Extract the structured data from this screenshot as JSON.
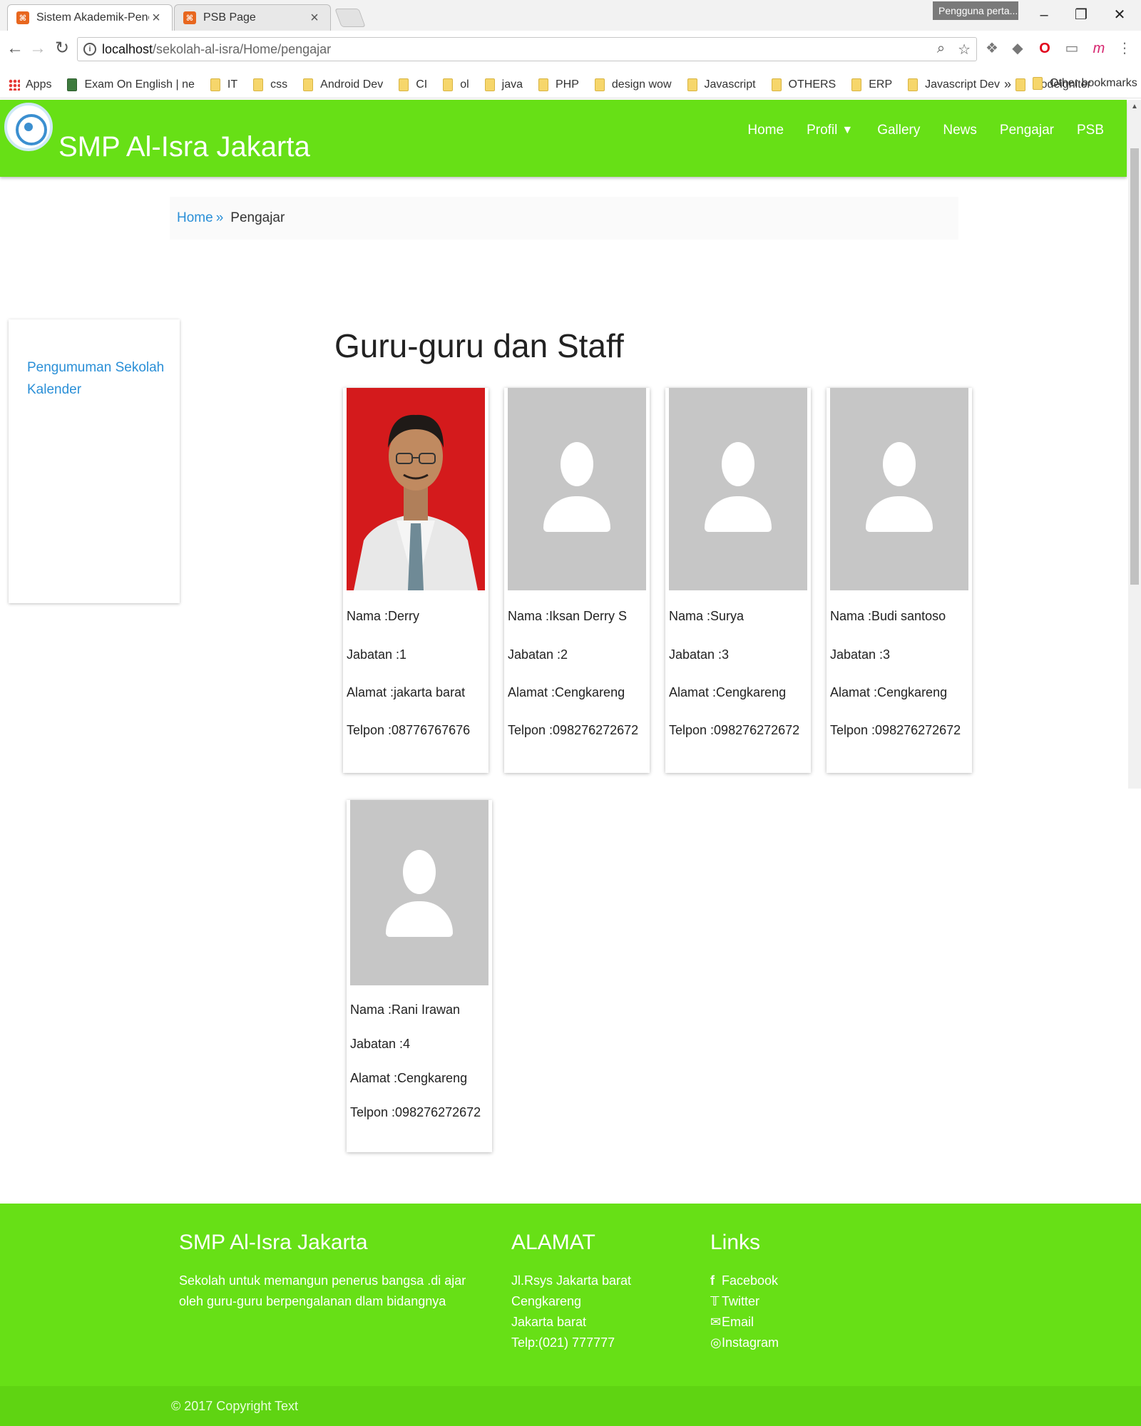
{
  "browser": {
    "tabs": [
      {
        "title": "Sistem Akademik-Penerim",
        "active": true
      },
      {
        "title": "PSB Page",
        "active": false
      }
    ],
    "profile_label": "Pengguna perta...",
    "url_host": "localhost",
    "url_path": "/sekolah-al-isra/Home/pengajar",
    "bookmarks": [
      "Apps",
      "Exam On English | ne",
      "IT",
      "css",
      "Android Dev",
      "CI",
      "ol",
      "java",
      "PHP",
      "design wow",
      "Javascript",
      "OTHERS",
      "ERP",
      "Javascript Dev",
      "Codeigniter"
    ],
    "bookmarks_more": "»",
    "other_bookmarks": "Other bookmarks"
  },
  "site": {
    "title": "SMP Al-Isra Jakarta",
    "nav": [
      "Home",
      "Profil",
      "Gallery",
      "News",
      "Pengajar",
      "PSB"
    ],
    "brand_color": "#67e016"
  },
  "breadcrumb": {
    "home": "Home",
    "separator": "»",
    "current": "Pengajar"
  },
  "sidebar": {
    "links": [
      "Pengumuman Sekolah",
      "Kalender"
    ]
  },
  "main": {
    "title": "Guru-guru dan Staff",
    "teachers": [
      {
        "nama": "Nama :Derry",
        "jabatan": "Jabatan :1",
        "alamat": "Alamat :jakarta barat",
        "telpon": "Telpon :08776767676",
        "photo": "portrait-photo"
      },
      {
        "nama": "Nama :Iksan Derry S",
        "jabatan": "Jabatan :2",
        "alamat": "Alamat :Cengkareng",
        "telpon": "Telpon :098276272672",
        "photo": "placeholder-avatar"
      },
      {
        "nama": "Nama :Surya",
        "jabatan": "Jabatan :3",
        "alamat": "Alamat :Cengkareng",
        "telpon": "Telpon :098276272672",
        "photo": "placeholder-avatar"
      },
      {
        "nama": "Nama :Budi santoso",
        "jabatan": "Jabatan :3",
        "alamat": "Alamat :Cengkareng",
        "telpon": "Telpon :098276272672",
        "photo": "placeholder-avatar"
      },
      {
        "nama": "Nama :Rani Irawan",
        "jabatan": "Jabatan :4",
        "alamat": "Alamat :Cengkareng",
        "telpon": "Telpon :098276272672",
        "photo": "placeholder-avatar"
      }
    ]
  },
  "footer": {
    "about_title": "SMP Al-Isra Jakarta",
    "about_text": "Sekolah untuk memangun penerus bangsa .di ajar oleh guru-guru berpengalanan dlam bidangnya",
    "address_title": "ALAMAT",
    "address_lines": [
      "Jl.Rsys Jakarta barat",
      "Cengkareng",
      "Jakarta barat",
      "Telp:(021) 777777"
    ],
    "links_title": "Links",
    "links": [
      {
        "label": "Facebook",
        "icon": "facebook-icon"
      },
      {
        "label": "Twitter",
        "icon": "twitter-icon"
      },
      {
        "label": "Email",
        "icon": "email-icon"
      },
      {
        "label": "Instagram",
        "icon": "instagram-icon"
      }
    ],
    "copyright": "© 2017 Copyright Text"
  }
}
